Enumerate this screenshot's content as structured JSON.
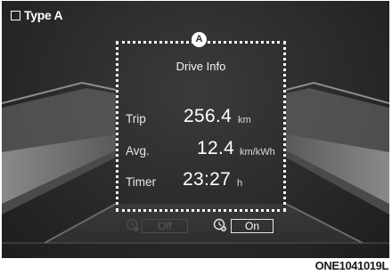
{
  "screen": {
    "type_label": "Type A",
    "callout": "A",
    "panel": {
      "title": "Drive Info",
      "rows": [
        {
          "label": "Trip",
          "value": "256.4",
          "unit": "km"
        },
        {
          "label": "Avg.",
          "value": "12.4",
          "unit": "km/kWh"
        },
        {
          "label": "Timer",
          "value": "23:27",
          "unit": "h"
        }
      ]
    },
    "toggles": {
      "off_label": "Off",
      "on_label": "On"
    },
    "icons": {
      "checkbox": "empty-checkbox-icon",
      "toggle_icon": "clock-fan-icon"
    },
    "figure_code": "ONE1041019L"
  }
}
